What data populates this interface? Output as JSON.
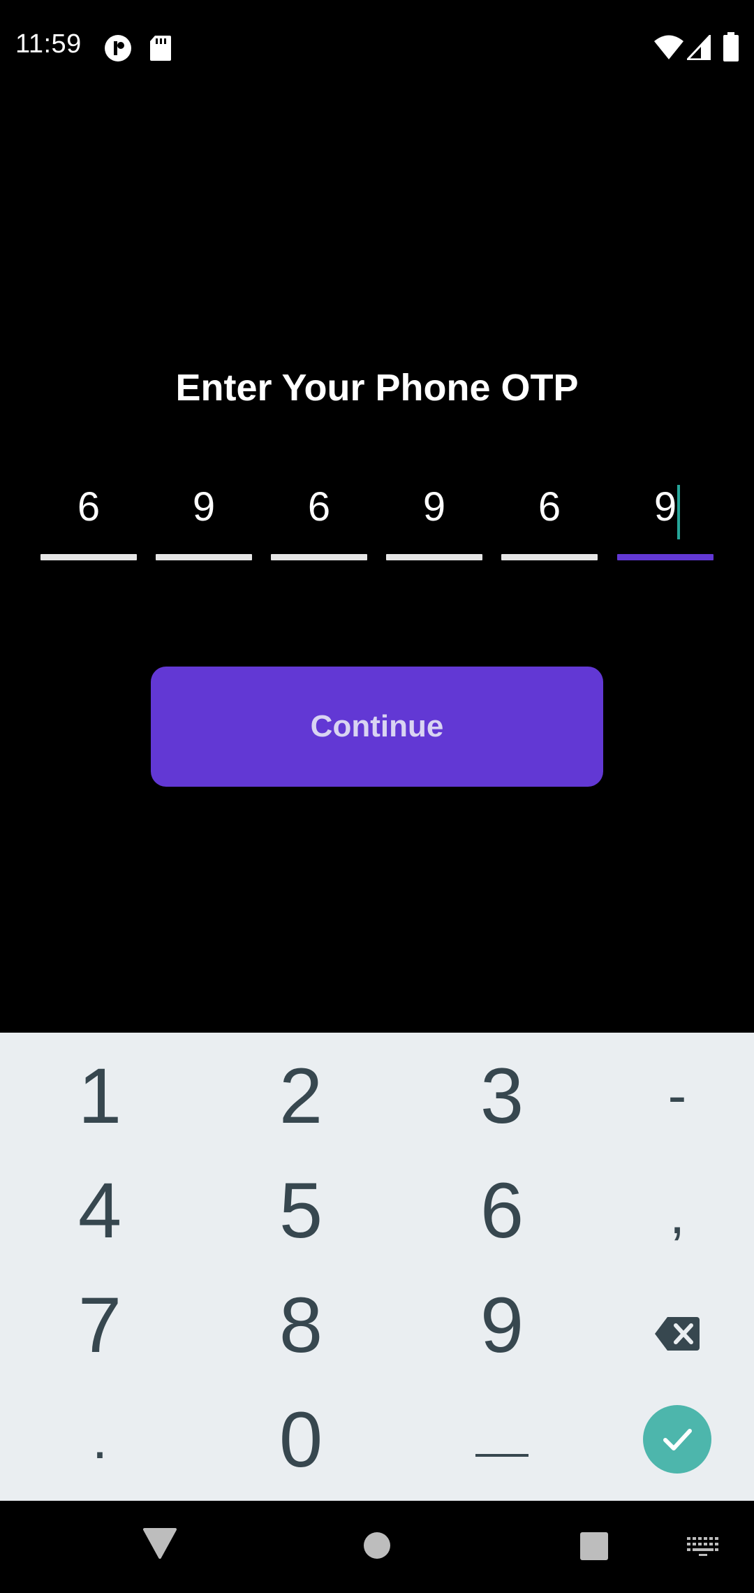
{
  "status_bar": {
    "time": "11:59",
    "left_icons": [
      "notification-app-icon",
      "sd-card-icon"
    ],
    "right_icons": [
      "wifi-icon",
      "cellular-signal-icon",
      "battery-icon"
    ]
  },
  "title": "Enter Your Phone OTP",
  "otp": {
    "digits": [
      "6",
      "9",
      "6",
      "9",
      "6",
      "9"
    ],
    "active_index": 5
  },
  "continue_label": "Continue",
  "keyboard": {
    "rows": [
      [
        "1",
        "2",
        "3",
        "-"
      ],
      [
        "4",
        "5",
        "6",
        ","
      ],
      [
        "7",
        "8",
        "9",
        "backspace-icon"
      ],
      [
        ".",
        "0",
        "space-icon",
        "confirm-icon"
      ]
    ]
  },
  "nav_bar": {
    "icons": [
      "back-icon",
      "home-icon",
      "recents-icon",
      "keyboard-switch-icon"
    ]
  },
  "colors": {
    "accent": "#6238d4",
    "cursor": "#26a69a",
    "confirm": "#4db6ac",
    "keyboard_bg": "#eaeef1",
    "key_text": "#37474f"
  }
}
